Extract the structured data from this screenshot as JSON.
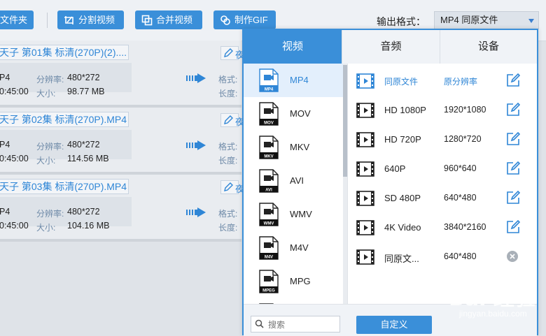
{
  "toolbar": {
    "folder_label": "文件夹",
    "split_label": "分割视频",
    "merge_label": "合并视频",
    "gif_label": "制作GIF",
    "output_label": "输出格式：",
    "output_value": "MP4  同原文件"
  },
  "files": [
    {
      "name": "天子 第01集 标清(270P)(2)....",
      "format": "P4",
      "duration": "0:45:00",
      "res_key": "分辨率:",
      "res": "480*272",
      "size_key": "大小:",
      "size": "98.77 MB",
      "edit": "夜",
      "fmt_key": "格式:",
      "len_key": "长度:"
    },
    {
      "name": "天子 第02集 标清(270P).MP4",
      "format": "P4",
      "duration": "0:45:00",
      "res_key": "分辨率:",
      "res": "480*272",
      "size_key": "大小:",
      "size": "114.56 MB",
      "edit": "夜",
      "fmt_key": "格式:",
      "len_key": "长度:"
    },
    {
      "name": "天子 第03集 标清(270P).MP4",
      "format": "P4",
      "duration": "0:45:00",
      "res_key": "分辨率:",
      "res": "480*272",
      "size_key": "大小:",
      "size": "104.16 MB",
      "edit": "夜",
      "fmt_key": "格式:",
      "len_key": "长度:"
    }
  ],
  "popup": {
    "tabs": [
      "视频",
      "音频",
      "设备"
    ],
    "formats": [
      {
        "name": "MP4",
        "badge": "MP4"
      },
      {
        "name": "MOV",
        "badge": "MOV"
      },
      {
        "name": "MKV",
        "badge": "MKV"
      },
      {
        "name": "AVI",
        "badge": "AVI"
      },
      {
        "name": "WMV",
        "badge": "WMV"
      },
      {
        "name": "M4V",
        "badge": "M4V"
      },
      {
        "name": "MPG",
        "badge": "MPEG"
      }
    ],
    "presets": [
      {
        "name": "同原文件",
        "res": "原分辨率"
      },
      {
        "name": "HD 1080P",
        "res": "1920*1080"
      },
      {
        "name": "HD 720P",
        "res": "1280*720"
      },
      {
        "name": "640P",
        "res": "960*640"
      },
      {
        "name": "SD 480P",
        "res": "640*480"
      },
      {
        "name": "4K Video",
        "res": "3840*2160"
      },
      {
        "name": "同原文...",
        "res": "640*480"
      }
    ],
    "search_placeholder": "搜索",
    "custom_label": "自定义"
  },
  "watermark": {
    "text": "Bai 经验",
    "url": "jingyan.baidu.com"
  },
  "colors": {
    "accent": "#3a8fd9",
    "link": "#2f86d6"
  }
}
